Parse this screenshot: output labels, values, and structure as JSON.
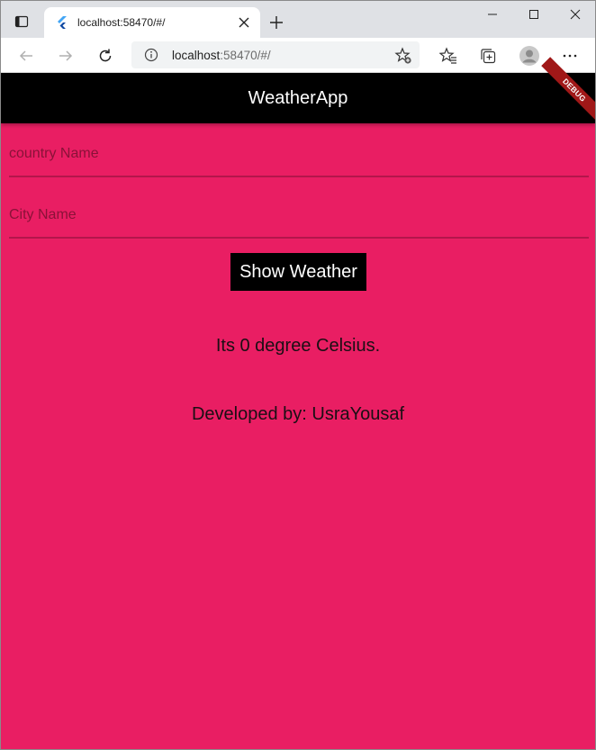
{
  "browser": {
    "tab_title": "localhost:58470/#/",
    "url_host": "localhost",
    "url_rest": ":58470/#/",
    "icons": {
      "tab_actions": "tab-actions-icon",
      "favicon": "flutter-icon",
      "close": "close-icon",
      "new_tab": "plus-icon",
      "back": "back-arrow-icon",
      "forward": "forward-arrow-icon",
      "reload": "reload-icon",
      "info": "info-icon",
      "add_favorite": "add-favorite-icon",
      "favorites": "favorites-icon",
      "collections": "collections-icon",
      "profile": "profile-icon",
      "more": "more-icon"
    }
  },
  "app": {
    "title": "WeatherApp",
    "debug_label": "DEBUG",
    "country_placeholder": "country Name",
    "city_placeholder": "City Name",
    "button_label": "Show Weather",
    "result_text": "Its 0 degree Celsius.",
    "developer_text": "Developed by: UsraYousaf",
    "colors": {
      "background": "#e91e63",
      "appbar": "#000000",
      "button": "#000000",
      "debug_banner": "#a01818"
    }
  }
}
